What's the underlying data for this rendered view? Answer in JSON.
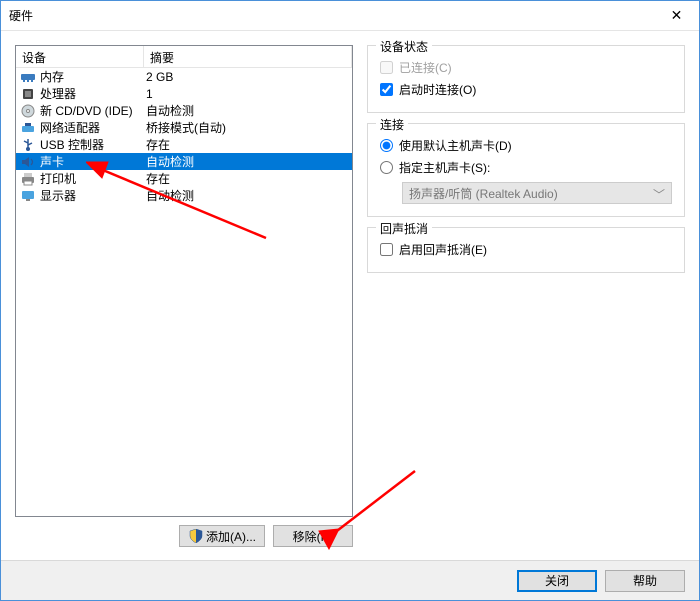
{
  "window": {
    "title": "硬件",
    "close": "✕"
  },
  "device_list": {
    "header_device": "设备",
    "header_summary": "摘要",
    "rows": [
      {
        "icon": "memory-icon",
        "name": "内存",
        "summary": "2 GB"
      },
      {
        "icon": "cpu-icon",
        "name": "处理器",
        "summary": "1"
      },
      {
        "icon": "cd-icon",
        "name": "新 CD/DVD (IDE)",
        "summary": "自动检测"
      },
      {
        "icon": "network-icon",
        "name": "网络适配器",
        "summary": "桥接模式(自动)"
      },
      {
        "icon": "usb-icon",
        "name": "USB 控制器",
        "summary": "存在"
      },
      {
        "icon": "sound-icon",
        "name": "声卡",
        "summary": "自动检测",
        "selected": true
      },
      {
        "icon": "printer-icon",
        "name": "打印机",
        "summary": "存在"
      },
      {
        "icon": "display-icon",
        "name": "显示器",
        "summary": "自动检测"
      }
    ]
  },
  "left_buttons": {
    "add": "添加(A)...",
    "remove": "移除(R)"
  },
  "right": {
    "status_group": "设备状态",
    "connected": "已连接(C)",
    "connect_at_poweron": "启动时连接(O)",
    "connection_group": "连接",
    "use_default": "使用默认主机声卡(D)",
    "specify": "指定主机声卡(S):",
    "speaker_value": "扬声器/听筒 (Realtek Audio)",
    "echo_group": "回声抵消",
    "enable_echo": "启用回声抵消(E)"
  },
  "bottom": {
    "close": "关闭",
    "help": "帮助"
  }
}
